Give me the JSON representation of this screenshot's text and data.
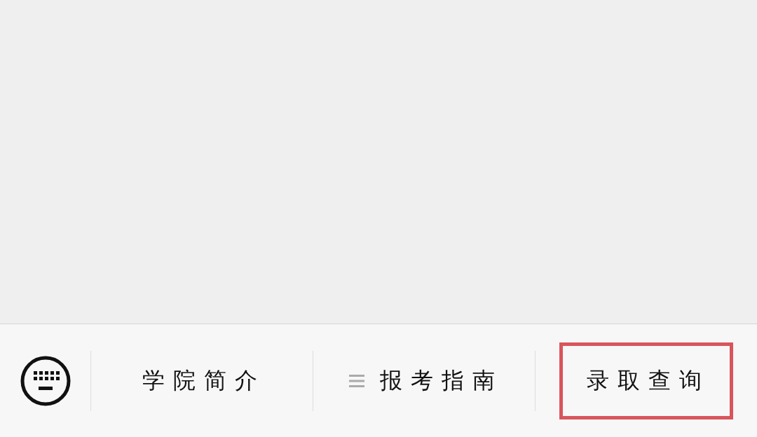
{
  "menu": {
    "items": [
      {
        "label": "学院简介",
        "has_submenu": false,
        "highlighted": false
      },
      {
        "label": "报考指南",
        "has_submenu": true,
        "highlighted": false
      },
      {
        "label": "录取查询",
        "has_submenu": false,
        "highlighted": true
      }
    ]
  }
}
